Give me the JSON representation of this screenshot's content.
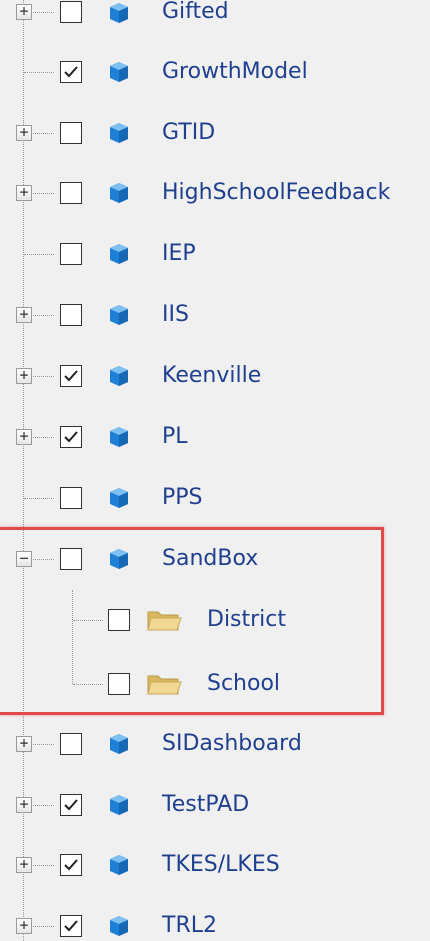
{
  "tree": {
    "items": [
      {
        "label": "Gifted",
        "checked": false,
        "icon": "database-icon",
        "expandable": true
      },
      {
        "label": "GrowthModel",
        "checked": true,
        "icon": "database-icon",
        "expandable": false
      },
      {
        "label": "GTID",
        "checked": false,
        "icon": "database-icon",
        "expandable": true
      },
      {
        "label": "HighSchoolFeedback",
        "checked": false,
        "icon": "database-icon",
        "expandable": true
      },
      {
        "label": "IEP",
        "checked": false,
        "icon": "database-icon",
        "expandable": false
      },
      {
        "label": "IIS",
        "checked": false,
        "icon": "database-icon",
        "expandable": true
      },
      {
        "label": "Keenville",
        "checked": true,
        "icon": "database-icon",
        "expandable": true
      },
      {
        "label": "PL",
        "checked": true,
        "icon": "database-icon",
        "expandable": true
      },
      {
        "label": "PPS",
        "checked": false,
        "icon": "database-icon",
        "expandable": false
      },
      {
        "label": "SandBox",
        "checked": false,
        "icon": "database-icon",
        "expandable": true,
        "expanded": true,
        "children": [
          {
            "label": "District",
            "checked": false,
            "icon": "folder-icon"
          },
          {
            "label": "School",
            "checked": false,
            "icon": "folder-icon"
          }
        ]
      },
      {
        "label": "SIDashboard",
        "checked": false,
        "icon": "database-icon",
        "expandable": true
      },
      {
        "label": "TestPAD",
        "checked": true,
        "icon": "database-icon",
        "expandable": true
      },
      {
        "label": "TKES/LKES",
        "checked": true,
        "icon": "database-icon",
        "expandable": true
      },
      {
        "label": "TRL2",
        "checked": true,
        "icon": "database-icon",
        "expandable": true
      }
    ]
  },
  "symbols": {
    "plus": "+",
    "minus": "−"
  },
  "colors": {
    "label": "#1f3f8f",
    "highlight": "#e04a4a",
    "database": "#1e7fd6",
    "folder": "#e7c77a"
  }
}
